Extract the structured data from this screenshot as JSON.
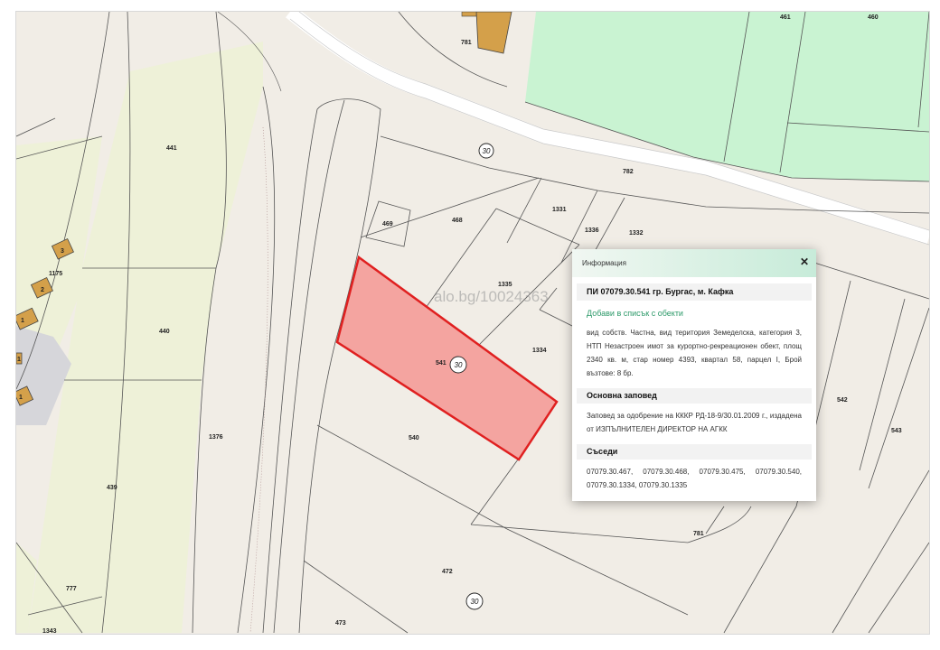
{
  "map": {
    "watermark": "alo.bg/10024363",
    "parcel_labels": {
      "p461": "461",
      "p460": "460",
      "p441": "441",
      "p440": "440",
      "p439": "439",
      "p469": "469",
      "p468": "468",
      "p1331": "1331",
      "p1336": "1336",
      "p1332": "1332",
      "p1335": "1335",
      "p1334": "1334",
      "p541": "541",
      "p540": "540",
      "p1175": "1175",
      "p1376": "1376",
      "p782": "782",
      "p781": "781",
      "p777": "777",
      "p472": "472",
      "p473": "473",
      "p542": "542",
      "p543": "543",
      "p781top": "781",
      "p1343": "1343"
    },
    "building_numbers": {
      "b3": "3",
      "b2": "2",
      "b1a": "1",
      "b1b": "1",
      "b1c": "1"
    },
    "road_number": "30",
    "colors": {
      "background": "#f1ede6",
      "agricultural": "#eef1d8",
      "green_zone": "#c9f3d2",
      "building": "#d4a04a",
      "selected_fill": "#f4a4a0",
      "selected_outline": "#e02020",
      "road": "#ffffff"
    }
  },
  "popup": {
    "header_title": "Информация",
    "close_icon": "✕",
    "pi_title": "ПИ 07079.30.541 гр. Бургас, м. Кафка",
    "add_link": "Добави в списък с обекти",
    "description": "вид собств. Частна, вид територия Земеделска, категория 3, НТП Незастроен имот за курортно-рекреационен обект, площ 2340 кв. м, стар номер 4393, квартал 58, парцел I, Брой възтове: 8 бр.",
    "order_title": "Основна заповед",
    "order_text": "Заповед за одобрение на КККР РД-18-9/30.01.2009 г., издадена от ИЗПЪЛНИТЕЛЕН ДИРЕКТОР НА АГКК",
    "neighbors_title": "Съседи",
    "neighbors_text": "07079.30.467, 07079.30.468, 07079.30.475, 07079.30.540, 07079.30.1334, 07079.30.1335"
  }
}
